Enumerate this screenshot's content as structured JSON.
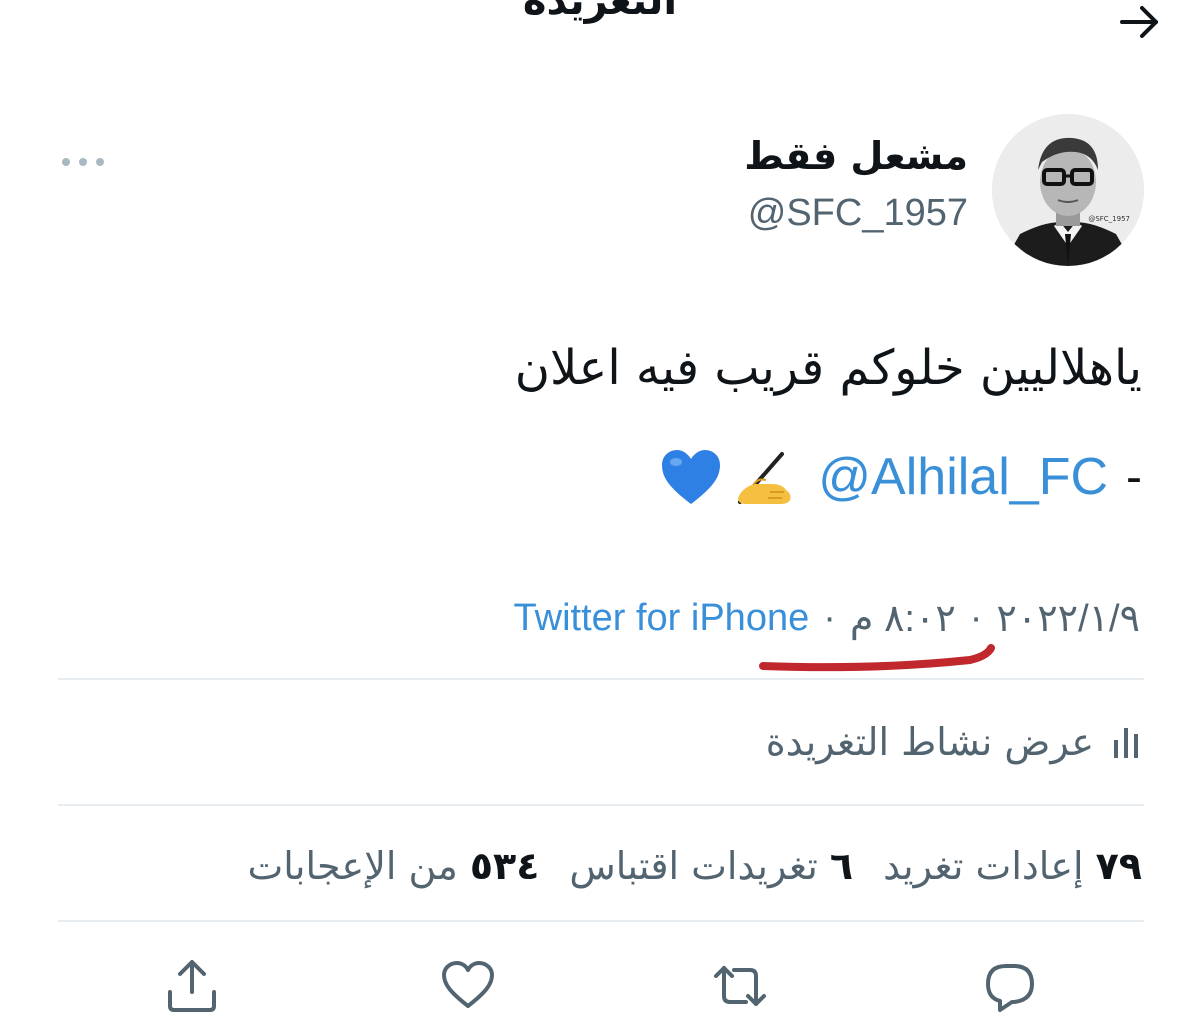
{
  "header": {
    "title": "التغريدة"
  },
  "author": {
    "display_name": "مشعل فقط",
    "handle": "@SFC_1957",
    "avatar_watermark": "@SFC_1957"
  },
  "tweet": {
    "line1": "ياهلاليين خلوكم قريب فيه اعلان",
    "dash": "-",
    "mention": "@Alhilal_FC",
    "emojis": [
      "writing-hand",
      "blue-heart"
    ]
  },
  "meta": {
    "date": "٢٠٢٢/١/٩",
    "time": "٨:٠٢ م",
    "separator": "·",
    "source": "Twitter for iPhone"
  },
  "activity": {
    "label": "عرض نشاط التغريدة"
  },
  "stats": {
    "retweets_count": "٧٩",
    "retweets_label": "إعادات تغريد",
    "quotes_count": "٦",
    "quotes_label": "تغريدات اقتباس",
    "likes_count": "٥٣٤",
    "likes_label": "من الإعجابات"
  },
  "actions": [
    "reply-icon",
    "retweet-icon",
    "like-icon",
    "share-icon"
  ],
  "colors": {
    "link": "#3a8fd9",
    "secondary_text": "#536471",
    "annotation_red": "#c0282d",
    "divider": "#e6ecf0"
  }
}
